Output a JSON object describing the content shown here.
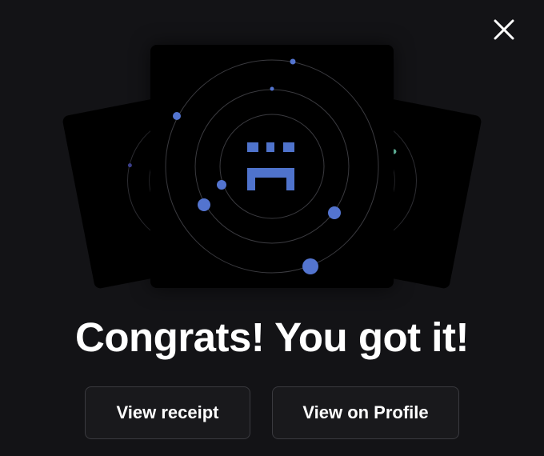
{
  "dialog": {
    "headline": "Congrats! You got it!",
    "close_icon": "close-icon"
  },
  "actions": {
    "view_receipt_label": "View receipt",
    "view_profile_label": "View on Profile"
  },
  "artwork": {
    "center_icon": "sad-face-pixel-icon",
    "colors": {
      "background": "#131316",
      "card": "#000000",
      "orbit_ring": "#3a3a3f",
      "accent_blue": "#5374cf",
      "dim_blue": "#3b3f8a",
      "accent_teal": "#7de8c7"
    }
  }
}
